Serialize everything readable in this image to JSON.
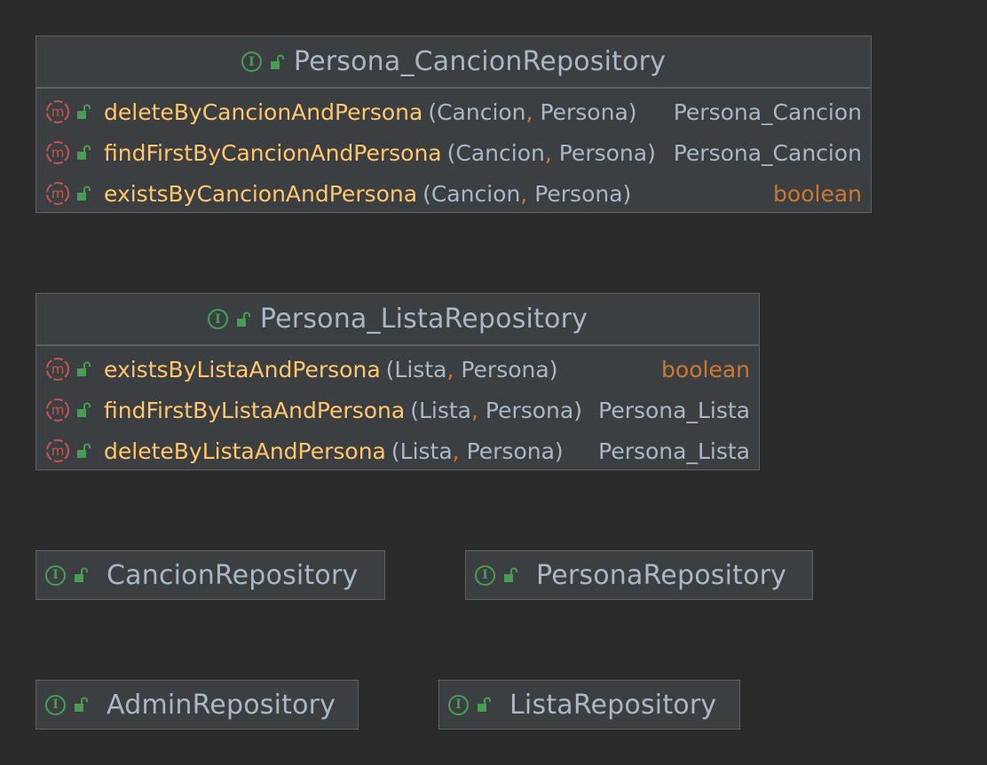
{
  "nodes": {
    "persona_cancion": {
      "title": "Persona_CancionRepository",
      "icon": "interface-icon",
      "methods": [
        {
          "name": "deleteByCancionAndPersona",
          "p1": "Cancion",
          "sep": ",",
          "p2": "Persona",
          "ret": "Persona_Cancion"
        },
        {
          "name": "findFirstByCancionAndPersona",
          "p1": "Cancion",
          "sep": ",",
          "p2": "Persona",
          "ret": "Persona_Cancion"
        },
        {
          "name": "existsByCancionAndPersona",
          "p1": "Cancion",
          "sep": ",",
          "p2": "Persona",
          "ret": "boolean"
        }
      ]
    },
    "persona_lista": {
      "title": "Persona_ListaRepository",
      "icon": "interface-icon",
      "methods": [
        {
          "name": "existsByListaAndPersona",
          "p1": "Lista",
          "sep": ",",
          "p2": "Persona",
          "ret": "boolean"
        },
        {
          "name": "findFirstByListaAndPersona",
          "p1": "Lista",
          "sep": ",",
          "p2": "Persona",
          "ret": "Persona_Lista"
        },
        {
          "name": "deleteByListaAndPersona",
          "p1": "Lista",
          "sep": ",",
          "p2": "Persona",
          "ret": "Persona_Lista"
        }
      ]
    },
    "cancion": {
      "title": "CancionRepository"
    },
    "persona": {
      "title": "PersonaRepository"
    },
    "admin": {
      "title": "AdminRepository"
    },
    "lista": {
      "title": "ListaRepository"
    }
  },
  "colors": {
    "background": "#2b2b2b",
    "node_bg": "#3c3f41",
    "method_name": "#ffc66d",
    "keyword": "#cc7832",
    "text": "#a9b7c6",
    "interface_green": "#499c54",
    "method_red": "#c75450"
  }
}
